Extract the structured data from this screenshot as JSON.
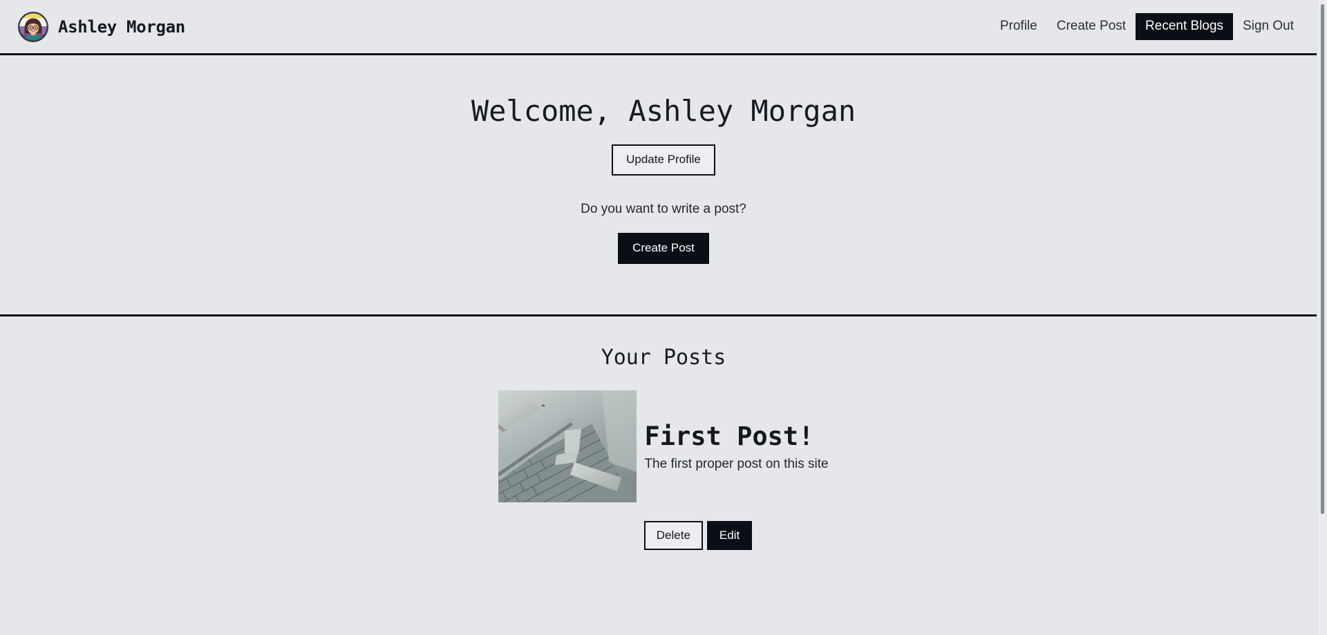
{
  "header": {
    "avatar_alt": "Ashley Morgan avatar",
    "brand_name": "Ashley Morgan",
    "nav": [
      {
        "label": "Profile",
        "active": false
      },
      {
        "label": "Create Post",
        "active": false
      },
      {
        "label": "Recent Blogs",
        "active": true
      },
      {
        "label": "Sign Out",
        "active": false
      }
    ]
  },
  "welcome": {
    "title": "Welcome, Ashley Morgan",
    "update_profile_label": "Update Profile",
    "write_prompt": "Do you want to write a post?",
    "create_post_label": "Create Post"
  },
  "posts": {
    "section_title": "Your Posts",
    "items": [
      {
        "title": "First Post!",
        "description": "The first proper post on this site",
        "image_alt": "Grayscale photo of cobblestone pavement and concrete slabs",
        "delete_label": "Delete",
        "edit_label": "Edit"
      }
    ]
  },
  "colors": {
    "background": "#e5e7eb",
    "ink": "#0b0e14",
    "text": "#23262c",
    "button_solid_text": "#ffffff",
    "scrollbar_thumb": "#868a92"
  }
}
